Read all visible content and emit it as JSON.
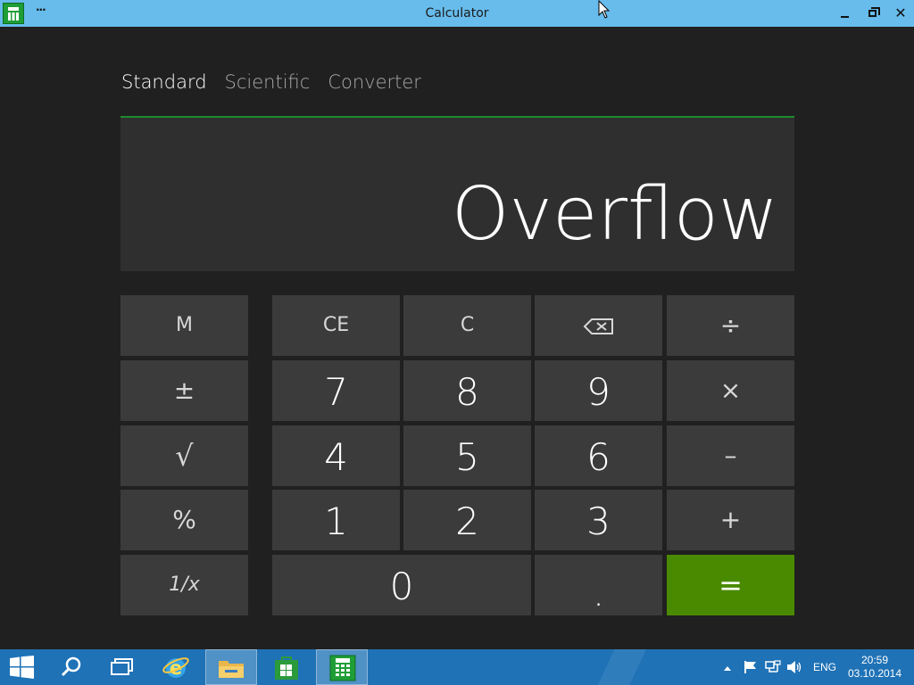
{
  "window": {
    "title": "Calculator",
    "menu_label": "···",
    "close_glyph": "✕"
  },
  "tabs": [
    {
      "label": "Standard",
      "active": true
    },
    {
      "label": "Scientific",
      "active": false
    },
    {
      "label": "Converter",
      "active": false
    }
  ],
  "display": {
    "value": "Overflow"
  },
  "keys": {
    "memory": "M",
    "negate": "±",
    "sqrt": "√",
    "percent": "%",
    "reciprocal": "1/x",
    "ce": "CE",
    "c": "C",
    "backspace": "backspace-icon",
    "divide": "÷",
    "multiply": "×",
    "subtract": "–",
    "add": "+",
    "equals": "=",
    "decimal": ".",
    "digits": {
      "0": "0",
      "1": "1",
      "2": "2",
      "3": "3",
      "4": "4",
      "5": "5",
      "6": "6",
      "7": "7",
      "8": "8",
      "9": "9"
    }
  },
  "colors": {
    "titlebar": "#67bcec",
    "accent_green": "#4a8a00",
    "display_border": "#1f8a2f",
    "taskbar": "#1f72b6"
  },
  "taskbar": {
    "start": "windows-logo-icon",
    "search": "search-icon",
    "task_view": "task-view-icon",
    "ie": "internet-explorer-icon",
    "explorer": "file-explorer-icon",
    "store": "store-icon",
    "calculator": "calculator-icon",
    "tray": {
      "language": "ENG",
      "time": "20:59",
      "date": "03.10.2014"
    }
  }
}
